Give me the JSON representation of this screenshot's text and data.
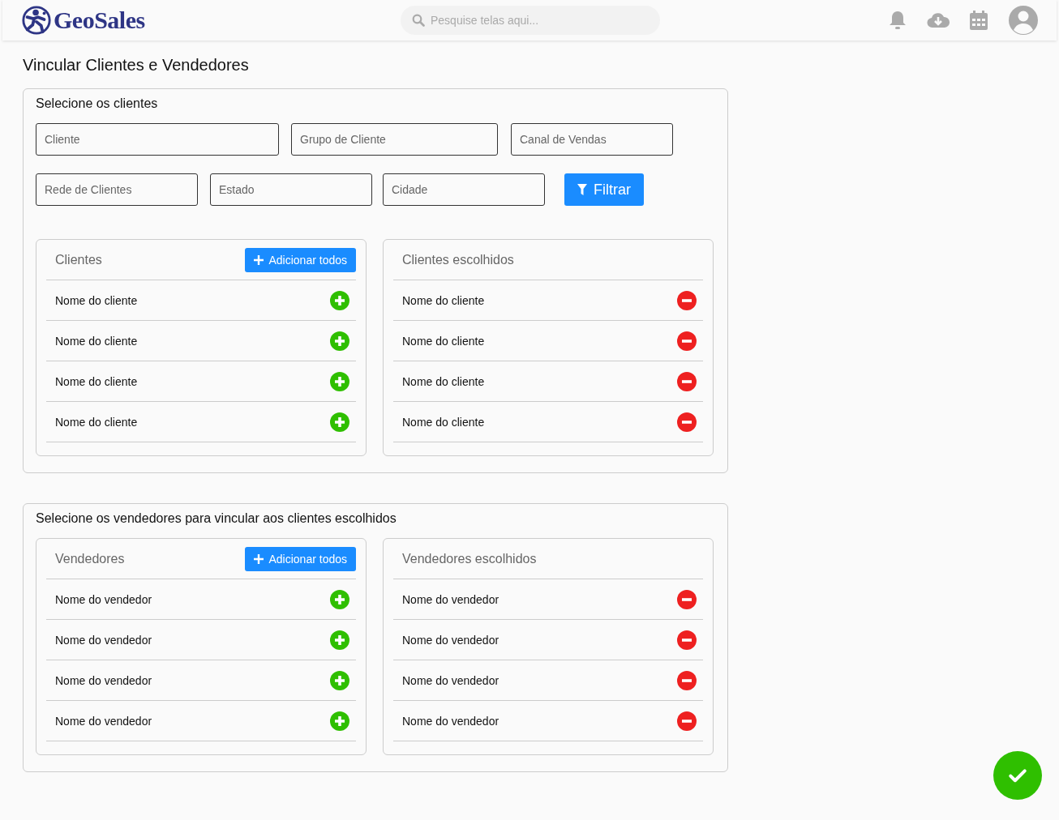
{
  "header": {
    "logo": "GeoSales",
    "search": {
      "placeholder": "Pesquise telas aqui..."
    }
  },
  "page_title": "Vincular Clientes e Vendedores",
  "sections": [
    {
      "title": "Selecione os clientes",
      "filters": [
        [
          {
            "placeholder": "Cliente"
          },
          {
            "placeholder": "Grupo de Cliente"
          },
          {
            "placeholder": "Canal de Vendas"
          }
        ],
        [
          {
            "placeholder": "Rede de Clientes"
          },
          {
            "placeholder": "Estado"
          },
          {
            "placeholder": "Cidade"
          }
        ]
      ],
      "filter_button": "Filtrar",
      "panels": [
        {
          "kind": "available",
          "title": "Clientes",
          "add_all_button": "Adicionar todos",
          "items": [
            "Nome do cliente",
            "Nome do cliente",
            "Nome do cliente",
            "Nome do cliente"
          ]
        },
        {
          "kind": "chosen",
          "title": "Clientes escolhidos",
          "items": [
            "Nome do cliente",
            "Nome do cliente",
            "Nome do cliente",
            "Nome do cliente"
          ]
        }
      ]
    },
    {
      "title": "Selecione os vendedores para vincular aos clientes escolhidos",
      "panels": [
        {
          "kind": "available",
          "title": "Vendedores",
          "add_all_button": "Adicionar todos",
          "items": [
            "Nome do vendedor",
            "Nome do vendedor",
            "Nome do vendedor",
            "Nome do vendedor"
          ]
        },
        {
          "kind": "chosen",
          "title": "Vendedores escolhidos",
          "items": [
            "Nome do vendedor",
            "Nome do vendedor",
            "Nome do vendedor",
            "Nome do vendedor"
          ]
        }
      ]
    }
  ]
}
